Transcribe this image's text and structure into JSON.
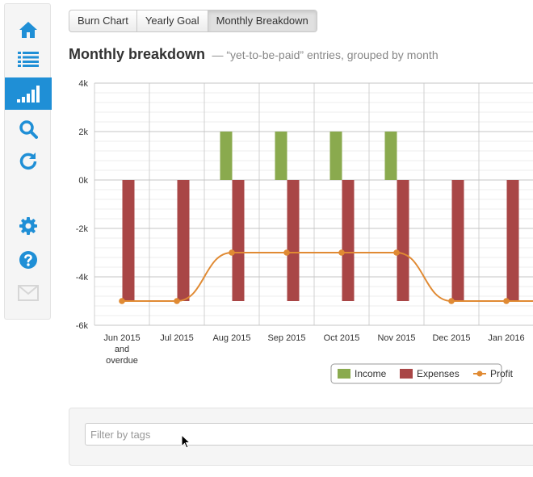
{
  "sidebar": {
    "items": [
      {
        "icon": "home-icon",
        "active": false
      },
      {
        "icon": "list-icon",
        "active": false
      },
      {
        "icon": "bar-signal-icon",
        "active": true
      },
      {
        "icon": "search-icon",
        "active": false
      },
      {
        "icon": "refresh-icon",
        "active": false
      },
      {
        "icon": "gear-icon",
        "active": false
      },
      {
        "icon": "help-icon",
        "active": false
      },
      {
        "icon": "mail-icon",
        "active": false,
        "disabled": true
      }
    ],
    "accent_color": "#1f8fd6",
    "icon_color": "#1f8fd6"
  },
  "tabs": [
    {
      "label": "Burn Chart",
      "active": false
    },
    {
      "label": "Yearly Goal",
      "active": false
    },
    {
      "label": "Monthly Breakdown",
      "active": true
    }
  ],
  "header": {
    "title": "Monthly breakdown",
    "subtitle": "— “yet-to-be-paid” entries, grouped by month"
  },
  "chart_data": {
    "type": "bar",
    "categories": [
      [
        "Jun 2015",
        "and",
        "overdue"
      ],
      [
        "Jul 2015"
      ],
      [
        "Aug 2015"
      ],
      [
        "Sep 2015"
      ],
      [
        "Oct 2015"
      ],
      [
        "Nov 2015"
      ],
      [
        "Dec 2015"
      ],
      [
        "Jan 2016"
      ]
    ],
    "series": [
      {
        "name": "Income",
        "kind": "bar",
        "color": "#8aaa4e",
        "values": [
          0,
          0,
          2000,
          2000,
          2000,
          2000,
          0,
          0
        ]
      },
      {
        "name": "Expenses",
        "kind": "bar",
        "color": "#a94646",
        "values": [
          -5000,
          -5000,
          -5000,
          -5000,
          -5000,
          -5000,
          -5000,
          -5000
        ]
      },
      {
        "name": "Profit",
        "kind": "line",
        "color": "#e08a33",
        "values": [
          -5000,
          -5000,
          -3000,
          -3000,
          -3000,
          -3000,
          -5000,
          -5000
        ]
      }
    ],
    "ylim": [
      -6000,
      4000
    ],
    "yticks": [
      {
        "value": 4000,
        "label": "4k"
      },
      {
        "value": 2000,
        "label": "2k"
      },
      {
        "value": 0,
        "label": "0k"
      },
      {
        "value": -2000,
        "label": "-2k"
      },
      {
        "value": -4000,
        "label": "-4k"
      },
      {
        "value": -6000,
        "label": "-6k"
      }
    ],
    "grid": true,
    "legend_position": "bottom-right"
  },
  "filter": {
    "placeholder": "Filter by tags"
  }
}
